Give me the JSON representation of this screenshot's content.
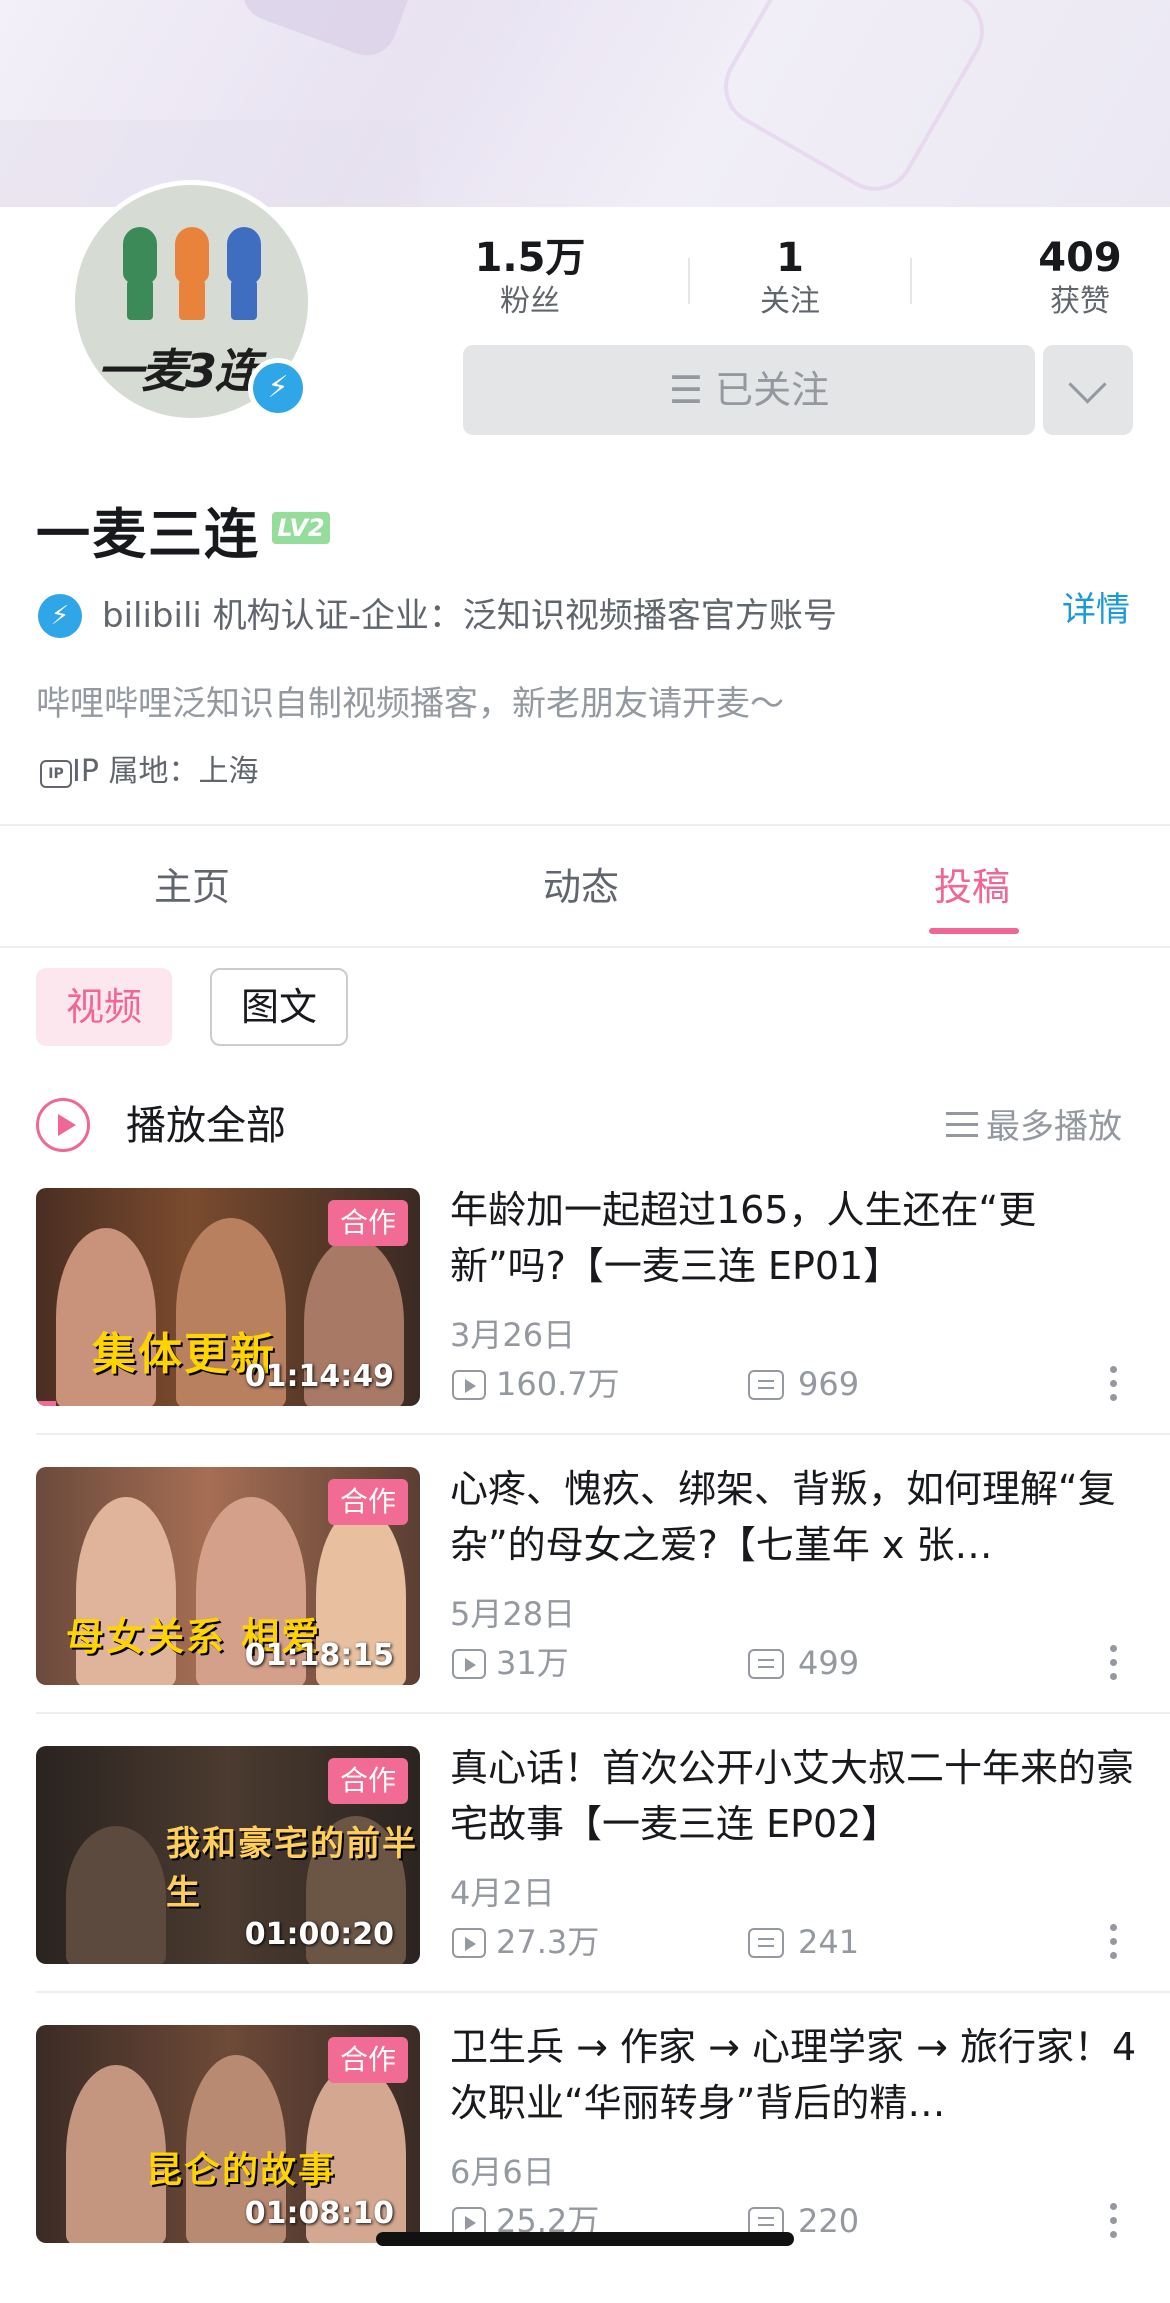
{
  "profile": {
    "name": "一麦三连",
    "level": "LV2",
    "avatar_text": "一麦3连",
    "stats": [
      {
        "value": "1.5万",
        "label": "粉丝"
      },
      {
        "value": "1",
        "label": "关注"
      },
      {
        "value": "409",
        "label": "获赞"
      }
    ],
    "follow_button": "☰ 已关注",
    "certification": "bilibili 机构认证-企业：泛知识视频播客官方账号",
    "detail_link": "详情",
    "sign": "哔哩哔哩泛知识自制视频播客，新老朋友请开麦～",
    "ip_icon": "IP",
    "ip": "IP 属地：上海"
  },
  "tabs": [
    {
      "label": "主页",
      "active": false
    },
    {
      "label": "动态",
      "active": false
    },
    {
      "label": "投稿",
      "active": true
    }
  ],
  "filters": {
    "video": "视频",
    "article": "图文"
  },
  "play_all": {
    "label": "播放全部",
    "sort_label": "最多播放"
  },
  "videos": [
    {
      "title": "年龄加一起超过165，人生还在“更新”吗?【一麦三连 EP01】",
      "date": "3月26日",
      "plays": "160.7万",
      "comments": "969",
      "duration": "01:14:49",
      "badge": "合作",
      "cover_text": "集体更新"
    },
    {
      "title": "心疼、愧疚、绑架、背叛，如何理解“复杂”的母女之爱?【七堇年 x 张…",
      "date": "5月28日",
      "plays": "31万",
      "comments": "499",
      "duration": "01:18:15",
      "badge": "合作",
      "cover_text": "母女关系 相爱"
    },
    {
      "title": "真心话！首次公开小艾大叔二十年来的豪宅故事【一麦三连 EP02】",
      "date": "4月2日",
      "plays": "27.3万",
      "comments": "241",
      "duration": "01:00:20",
      "badge": "合作",
      "cover_text": "我和豪宅的前半生"
    },
    {
      "title": "卫生兵 → 作家 → 心理学家 → 旅行家！4次职业“华丽转身”背后的精…",
      "date": "6月6日",
      "plays": "25.2万",
      "comments": "220",
      "duration": "01:08:10",
      "badge": "合作",
      "cover_text": "昆仑的故事"
    }
  ],
  "colors": {
    "accent": "#f06695",
    "badge": "#f16b95",
    "link": "#1a9ad8",
    "verify": "#2ea6e7",
    "level": "#95dd9b"
  },
  "icons": [
    "verified-bolt-icon",
    "chevron-down-icon",
    "play-circle-icon",
    "sort-list-icon",
    "play-count-icon",
    "comment-icon",
    "more-vertical-icon",
    "ip-icon"
  ]
}
